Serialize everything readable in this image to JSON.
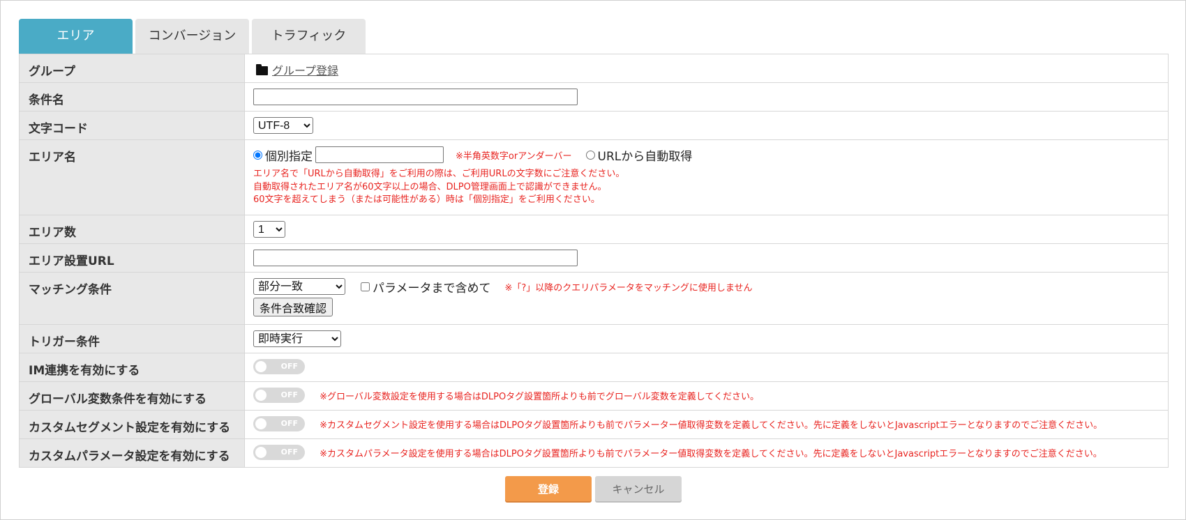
{
  "tabs": [
    {
      "label": "エリア",
      "active": true
    },
    {
      "label": "コンバージョン",
      "active": false
    },
    {
      "label": "トラフィック",
      "active": false
    }
  ],
  "rows": {
    "group": {
      "label": "グループ",
      "link": "グループ登録"
    },
    "condition_name": {
      "label": "条件名",
      "value": ""
    },
    "charset": {
      "label": "文字コード",
      "selected": "UTF-8"
    },
    "area_name": {
      "label": "エリア名",
      "radio_individual": "個別指定",
      "radio_individual_checked": true,
      "individual_value": "",
      "hint": "※半角英数字orアンダーバー",
      "radio_auto": "URLから自動取得",
      "notes": [
        "エリア名で「URLから自動取得」をご利用の際は、ご利用URLの文字数にご注意ください。",
        "自動取得されたエリア名が60文字以上の場合、DLPO管理画面上で認識ができません。",
        "60文字を超えてしまう（または可能性がある）時は「個別指定」をご利用ください。"
      ]
    },
    "area_count": {
      "label": "エリア数",
      "selected": "1"
    },
    "area_url": {
      "label": "エリア設置URL",
      "value": ""
    },
    "matching": {
      "label": "マッチング条件",
      "selected": "部分一致",
      "checkbox_label": "パラメータまで含めて",
      "checkbox_checked": false,
      "note": "※「?」以降のクエリパラメータをマッチングに使用しません",
      "button": "条件合致確認"
    },
    "trigger": {
      "label": "トリガー条件",
      "selected": "即時実行"
    },
    "im": {
      "label": "IM連携を有効にする",
      "toggle": "OFF"
    },
    "global_var": {
      "label": "グローバル変数条件を有効にする",
      "toggle": "OFF",
      "note": "※グローバル変数設定を使用する場合はDLPOタグ設置箇所よりも前でグローバル変数を定義してください。"
    },
    "custom_segment": {
      "label": "カスタムセグメント設定を有効にする",
      "toggle": "OFF",
      "note": "※カスタムセグメント設定を使用する場合はDLPOタグ設置箇所よりも前でパラメーター値取得変数を定義してください。先に定義をしないとJavascriptエラーとなりますのでご注意ください。"
    },
    "custom_param": {
      "label": "カスタムパラメータ設定を有効にする",
      "toggle": "OFF",
      "note": "※カスタムパラメータ設定を使用する場合はDLPOタグ設置箇所よりも前でパラメーター値取得変数を定義してください。先に定義をしないとJavascriptエラーとなりますのでご注意ください。"
    }
  },
  "buttons": {
    "submit": "登録",
    "cancel": "キャンセル"
  },
  "colors": {
    "tab_active": "#4aabc6",
    "submit": "#f39a4a",
    "note_red": "#e8231f"
  }
}
